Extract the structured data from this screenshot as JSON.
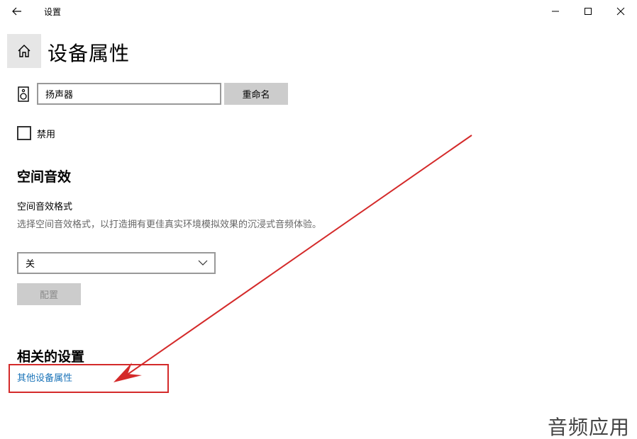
{
  "window": {
    "title": "设置",
    "controls": {
      "minimize": "minimize-icon",
      "maximize": "maximize-icon",
      "close": "close-icon"
    }
  },
  "header": {
    "home_icon": "home-icon",
    "title": "设备属性"
  },
  "device": {
    "icon": "speaker-icon",
    "name_value": "扬声器",
    "rename_label": "重命名"
  },
  "disable": {
    "label": "禁用",
    "checked": false
  },
  "spatial": {
    "title": "空间音效",
    "format_label": "空间音效格式",
    "description": "选择空间音效格式，以打造拥有更佳真实环境模拟效果的沉浸式音频体验。",
    "selected": "关",
    "config_label": "配置"
  },
  "related": {
    "title": "相关的设置",
    "link": "其他设备属性"
  },
  "annotation": {
    "color": "#d42a2a"
  },
  "watermark": "音频应用",
  "colors": {
    "link": "#1a73b8",
    "button_bg": "#cccccc",
    "home_bg": "#e6e6e6"
  }
}
